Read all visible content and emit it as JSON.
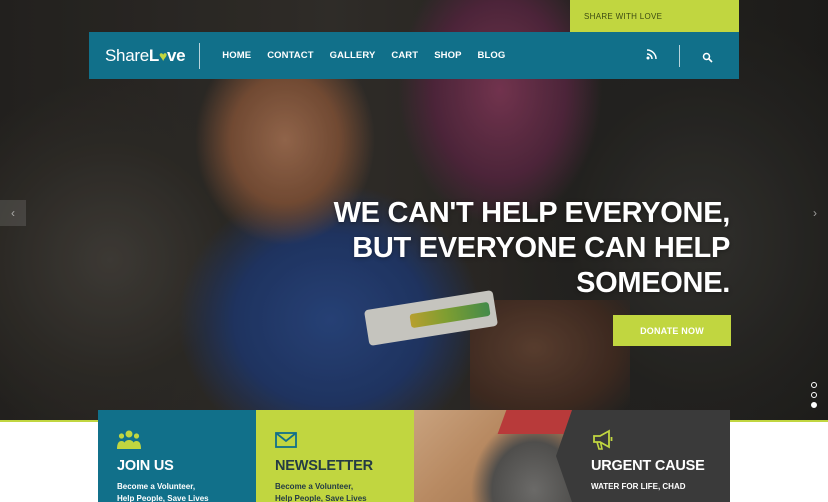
{
  "top_strip": {
    "label": "SHARE WITH LOVE"
  },
  "navbar": {
    "logo_part1": "Share",
    "logo_part2": "L",
    "logo_heart": "♥",
    "logo_part3": "ve",
    "links": [
      "HOME",
      "CONTACT",
      "GALLERY",
      "CART",
      "SHOP",
      "BLOG"
    ]
  },
  "hero": {
    "headline_lines": [
      "WE CAN'T HELP EVERYONE,",
      "BUT EVERYONE CAN HELP",
      "SOMEONE."
    ],
    "cta_label": "DONATE NOW",
    "arrow_left": "‹",
    "arrow_right": "›"
  },
  "features": {
    "join": {
      "title": "JOIN US",
      "text_line1": "Become a Volunteer,",
      "text_line2": "Help People, Save Lives"
    },
    "newsletter": {
      "title": "NEWSLETTER",
      "text_line1": "Become a Volunteer,",
      "text_line2": "Help People, Save Lives"
    },
    "urgent": {
      "title": "URGENT CAUSE",
      "subtitle": "WATER FOR LIFE, CHAD"
    }
  },
  "icons": [
    "rss-icon",
    "search-icon",
    "people-icon",
    "envelope-icon",
    "megaphone-icon"
  ],
  "colors": {
    "teal": "#11708a",
    "lime": "#c1d640",
    "dark": "#3a3a3a"
  }
}
